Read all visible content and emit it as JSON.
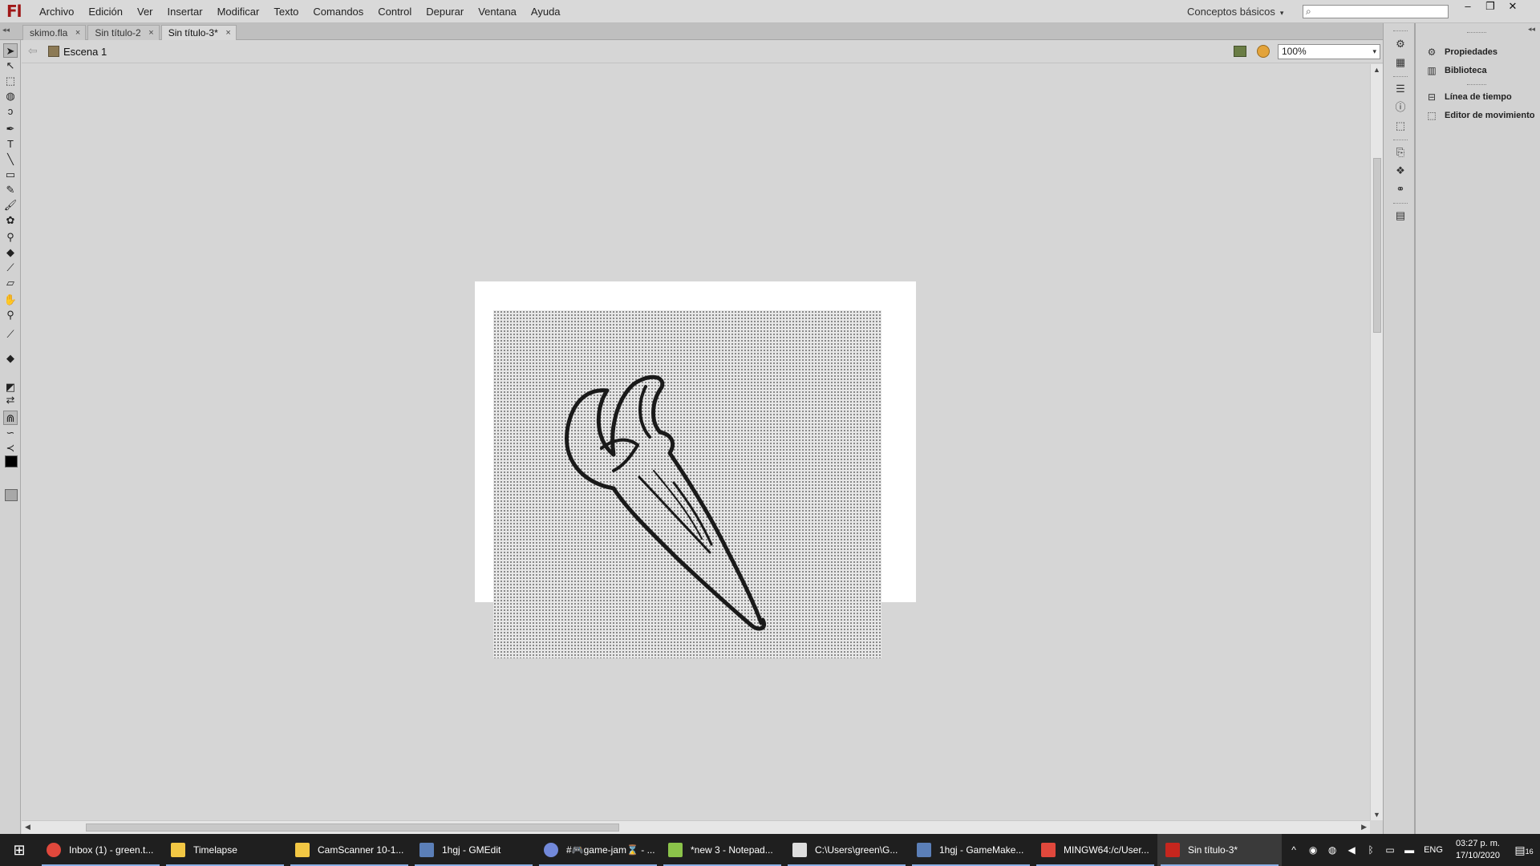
{
  "app": {
    "logo": "Fl"
  },
  "menu": [
    "Archivo",
    "Edición",
    "Ver",
    "Insertar",
    "Modificar",
    "Texto",
    "Comandos",
    "Control",
    "Depurar",
    "Ventana",
    "Ayuda"
  ],
  "workspace": {
    "label": "Conceptos básicos"
  },
  "search": {
    "placeholder": ""
  },
  "window_controls": {
    "minimize": "–",
    "restore": "❐",
    "close": "✕"
  },
  "tabs": [
    {
      "label": "skimo.fla",
      "close": "×"
    },
    {
      "label": "Sin título-2",
      "close": "×"
    },
    {
      "label": "Sin título-3*",
      "close": "×",
      "active": true
    }
  ],
  "editbar": {
    "scene": "Escena 1",
    "zoom": "100%"
  },
  "tools": [
    "selection-tool",
    "subselection-tool",
    "free-transform-tool",
    "3d-rotation-tool",
    "lasso-tool",
    "pen-tool",
    "text-tool",
    "line-tool",
    "rectangle-tool",
    "pencil-tool",
    "brush-tool",
    "deco-tool",
    "bone-tool",
    "paint-bucket-tool",
    "eyedropper-tool",
    "eraser-tool",
    "hand-tool",
    "zoom-tool"
  ],
  "colors": {
    "stroke": "#000000",
    "fill": "#a8a8a8",
    "stage": "#ffffff",
    "pasteboard": "#d6d6d6"
  },
  "panels": {
    "group1": [
      "Propiedades",
      "Biblioteca"
    ],
    "group2": [
      "Línea de tiempo",
      "Editor de movimiento"
    ]
  },
  "taskbar": {
    "items": [
      {
        "label": "Inbox (1) - green.t...",
        "icon": "chrome-icon",
        "color": "#e0483c"
      },
      {
        "label": "Timelapse",
        "icon": "folder-icon",
        "color": "#f2c744"
      },
      {
        "label": "CamScanner 10-1...",
        "icon": "folder-icon",
        "color": "#f2c744"
      },
      {
        "label": "1hgj - GMEdit",
        "icon": "gmedit-icon",
        "color": "#5b7fb8"
      },
      {
        "label": "#🎮game-jam⌛ - ...",
        "icon": "discord-icon",
        "color": "#7289da"
      },
      {
        "label": "*new 3 - Notepad...",
        "icon": "notepad-icon",
        "color": "#8bc34a"
      },
      {
        "label": "C:\\Users\\green\\G...",
        "icon": "console-icon",
        "color": "#dddddd"
      },
      {
        "label": "1hgj - GameMake...",
        "icon": "gamemaker-icon",
        "color": "#5b7fb8"
      },
      {
        "label": "MINGW64:/c/User...",
        "icon": "git-icon",
        "color": "#e0483c"
      },
      {
        "label": "Sin título-3*",
        "icon": "flash-icon",
        "color": "#c6261e",
        "active": true
      }
    ],
    "tray": {
      "lang": "ENG",
      "time": "03:27 p. m.",
      "date": "17/10/2020",
      "notifications": "16"
    }
  }
}
